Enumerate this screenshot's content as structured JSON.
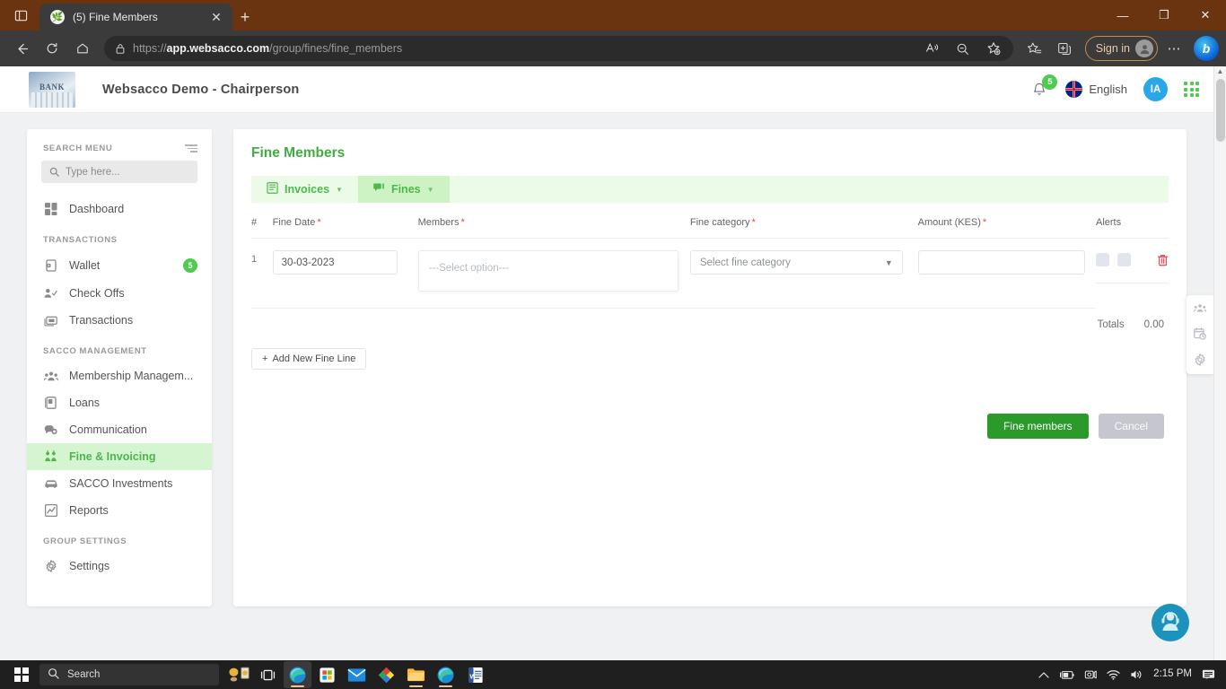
{
  "browser": {
    "tab": {
      "title": "(5) Fine Members",
      "favicon": "leaf-icon",
      "close": "✕"
    },
    "new_tab_label": "+",
    "tab_strip_icon": "tab-list-icon",
    "url_prefix": "https://",
    "url_bold": "app.websacco.com",
    "url_rest": "/group/fines/fine_members",
    "signin_label": "Sign in",
    "window_controls": {
      "minimize": "—",
      "maximize": "❐",
      "close": "✕"
    },
    "toolbar_icons": [
      "back-icon",
      "refresh-icon",
      "home-icon",
      "read-aloud-icon",
      "zoom-out-icon",
      "add-favorite-icon",
      "favorites-icon",
      "collections-icon",
      "settings-more-icon",
      "bing-chat-icon"
    ]
  },
  "app_header": {
    "logo_text": "BANK",
    "title": "Websacco Demo - Chairperson",
    "notification_count": "5",
    "language": "English",
    "avatar_initials": "IA",
    "apps_grid": "apps-grid-icon"
  },
  "sidebar": {
    "search_label": "SEARCH MENU",
    "search_placeholder": "Type here...",
    "search_value": "",
    "groups": [
      {
        "section": null,
        "items": [
          {
            "label": "Dashboard",
            "icon": "dashboard-icon",
            "badge": null,
            "active": false
          }
        ]
      },
      {
        "section": "TRANSACTIONS",
        "items": [
          {
            "label": "Wallet",
            "icon": "wallet-icon",
            "badge": "5",
            "active": false
          },
          {
            "label": "Check Offs",
            "icon": "check-offs-icon",
            "badge": null,
            "active": false
          },
          {
            "label": "Transactions",
            "icon": "transactions-icon",
            "badge": null,
            "active": false
          }
        ]
      },
      {
        "section": "SACCO MANAGEMENT",
        "items": [
          {
            "label": "Membership Managem...",
            "icon": "members-icon",
            "badge": null,
            "active": false
          },
          {
            "label": "Loans",
            "icon": "loans-icon",
            "badge": null,
            "active": false
          },
          {
            "label": "Communication",
            "icon": "communication-icon",
            "badge": null,
            "active": false
          },
          {
            "label": "Fine & Invoicing",
            "icon": "fine-invoicing-icon",
            "badge": null,
            "active": true
          },
          {
            "label": "SACCO Investments",
            "icon": "investments-icon",
            "badge": null,
            "active": false
          },
          {
            "label": "Reports",
            "icon": "reports-icon",
            "badge": null,
            "active": false
          }
        ]
      },
      {
        "section": "GROUP SETTINGS",
        "items": [
          {
            "label": "Settings",
            "icon": "settings-gear-icon",
            "badge": null,
            "active": false
          }
        ]
      }
    ]
  },
  "main": {
    "page_title": "Fine Members",
    "tabs": [
      {
        "label": "Invoices",
        "icon": "invoice-icon",
        "selected": false
      },
      {
        "label": "Fines",
        "icon": "fine-icon",
        "selected": true
      }
    ],
    "table": {
      "headers": [
        {
          "label": "#",
          "required": false
        },
        {
          "label": "Fine Date",
          "required": true
        },
        {
          "label": "Members",
          "required": true
        },
        {
          "label": "Fine category",
          "required": true
        },
        {
          "label": "Amount (KES)",
          "required": true
        },
        {
          "label": "Alerts",
          "required": false
        }
      ],
      "rows": [
        {
          "num": "1",
          "fine_date": "30-03-2023",
          "members_placeholder": "---Select option---",
          "members_value": "",
          "category_value": "Select fine category",
          "amount_value": "",
          "amount_placeholder": "",
          "alerts": [
            "sms-toggle",
            "email-toggle"
          ],
          "delete": "trash-icon"
        }
      ]
    },
    "totals_label": "Totals",
    "totals_value": "0.00",
    "add_line_label": "Add New Fine Line",
    "add_line_icon": "plus-icon",
    "submit_label": "Fine members",
    "cancel_label": "Cancel"
  },
  "dock": {
    "items": [
      "group-members-icon",
      "calendar-clock-icon",
      "settings-gear-icon"
    ]
  },
  "chat_widget": {
    "icon": "support-headset-icon"
  },
  "taskbar": {
    "start": "windows-start-icon",
    "search_placeholder": "Search",
    "widget_icon": "weather-widget-icon",
    "taskview_icon": "task-view-icon",
    "apps": [
      "edge-browser-icon",
      "microsoft-store-icon",
      "mail-icon",
      "paint-icon",
      "file-explorer-icon",
      "edge-icon",
      "word-icon"
    ],
    "tray": [
      "chevron-up-icon",
      "battery-icon",
      "camera-icon",
      "wifi-icon",
      "volume-icon"
    ],
    "clock": "2:15 PM",
    "notification_icon": "notification-center-icon"
  },
  "colors": {
    "accent_green": "#4fcb4f",
    "title_green": "#3fae3f",
    "tab_bg": "#ecfbe8",
    "tab_sel_bg": "#cdf3c4",
    "avatar_blue": "#29a7e8",
    "danger_red": "#ef5060",
    "browser_titlebar": "#6b3410"
  }
}
